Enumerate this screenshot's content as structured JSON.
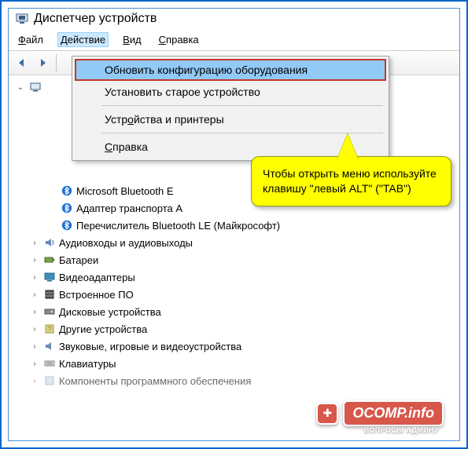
{
  "window": {
    "title": "Диспетчер устройств"
  },
  "menu": {
    "file": "Файл",
    "action": "Действие",
    "view": "Вид",
    "help": "Справка"
  },
  "dropdown": {
    "scan": "Обновить конфигурацию оборудования",
    "legacy": "Установить старое устройство",
    "devices": "Устройства и принтеры",
    "help": "Справка"
  },
  "tree": {
    "root": "",
    "bt1": "Microsoft Bluetooth E",
    "bt2": "Адаптер транспорта A",
    "bt3": "Перечислитель Bluetooth LE (Майкрософт)",
    "audio": "Аудиовходы и аудиовыходы",
    "battery": "Батареи",
    "video": "Видеоадаптеры",
    "firmware": "Встроенное ПО",
    "disk": "Дисковые устройства",
    "other": "Другие устройства",
    "sound": "Звуковые, игровые и видеоустройства",
    "keyboard": "Клавиатуры",
    "components": "Компоненты программного обеспечения"
  },
  "callout": {
    "text": "Чтобы открыть меню используйте клавишу \"левый ALT\" (\"TAB\")"
  },
  "watermark": {
    "main": "OCOMP.info",
    "sub": "ВОПРОСЫ АДМИНУ"
  }
}
